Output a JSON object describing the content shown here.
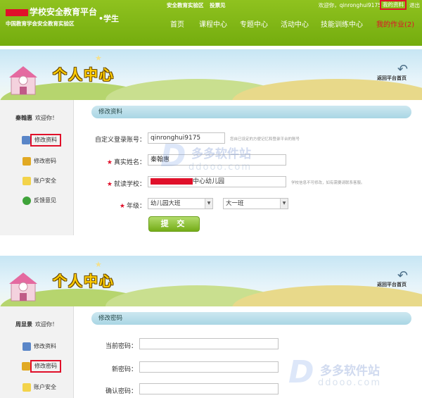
{
  "header": {
    "logo_suffix": "学校安全教育平台",
    "logo_sub": "中国教育学会安全教育实验区",
    "role": "•学生",
    "area_links": [
      "安全教育实验区",
      "投票见"
    ],
    "user_greeting": "欢迎你，qinronghui9175",
    "my_info": "我的资料",
    "logout": "退出",
    "nav": [
      "首页",
      "课程中心",
      "专题中心",
      "活动中心",
      "技能训练中心",
      "我的作业(2)"
    ]
  },
  "banner": {
    "title": "个人中心",
    "back": "返回平台首页"
  },
  "panel1": {
    "welcome_name": "秦翰惠",
    "welcome_text": "欢迎你！",
    "sidebar": [
      "修改资料",
      "修改密码",
      "账户安全",
      "反馈意见"
    ],
    "section": "修改资料",
    "form": {
      "login_label": "自定义登录账号：",
      "login_value": "qinronghui9175",
      "login_hint": "您自已设定的方便记忆和登录平台的账号",
      "name_label": "真实姓名：",
      "name_value": "秦翰惠",
      "school_label": "就读学校：",
      "school_value": "中心幼儿园",
      "school_hint": "学校信息不可修改，如有需要请联系客服。",
      "grade_label": "年级：",
      "grade_value": "幼儿园大班",
      "class_value": "大一班",
      "submit": "提 交"
    }
  },
  "panel2": {
    "welcome_name": "周显景",
    "welcome_text": "欢迎你！",
    "sidebar": [
      "修改资料",
      "修改密码",
      "账户安全"
    ],
    "section": "修改密码",
    "form": {
      "current_label": "当前密码：",
      "new_label": "新密码：",
      "confirm_label": "确认密码："
    }
  },
  "watermark": {
    "cn": "多多软件站",
    "en": "ddooo.com"
  }
}
